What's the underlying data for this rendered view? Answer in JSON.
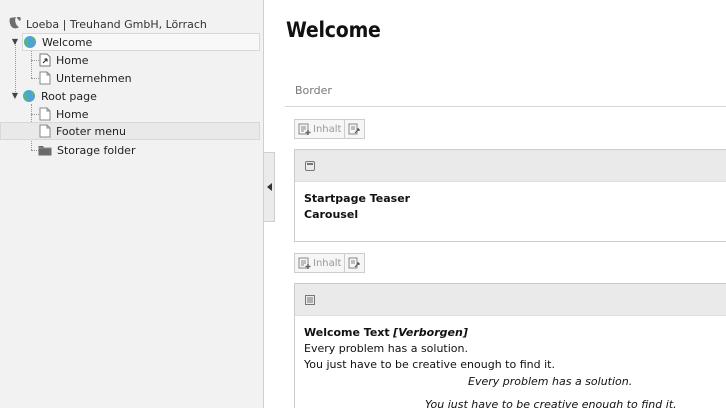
{
  "tree": {
    "site_root": "Loeba | Treuhand GmbH, Lörrach",
    "nodes": [
      {
        "label": "Welcome",
        "type": "root-page",
        "expanded": true
      },
      {
        "label": "Home",
        "type": "shortcut-page"
      },
      {
        "label": "Unternehmen",
        "type": "page"
      },
      {
        "label": "Root page",
        "type": "root-page",
        "expanded": true
      },
      {
        "label": "Home",
        "type": "page"
      },
      {
        "label": "Footer menu",
        "type": "page"
      },
      {
        "label": "Storage folder",
        "type": "folder"
      }
    ]
  },
  "content": {
    "title": "Welcome",
    "column": "Border",
    "new_button_label": "Inhalt",
    "elements": [
      {
        "title": "Startpage Teaser",
        "subtitle": "Carousel"
      },
      {
        "title": "Welcome Text",
        "hidden_tag": "[Verborgen]",
        "line1": "Every problem has a solution.",
        "line2": "You just have to be creative enough to find it.",
        "line3": "Every problem has a solution.",
        "line4": "You just have to be creative enough to find it."
      }
    ]
  },
  "colors": {
    "tree_bg": "#f2f2f2",
    "header_bg": "#eaeaea",
    "accent_orange": "#f49700"
  }
}
